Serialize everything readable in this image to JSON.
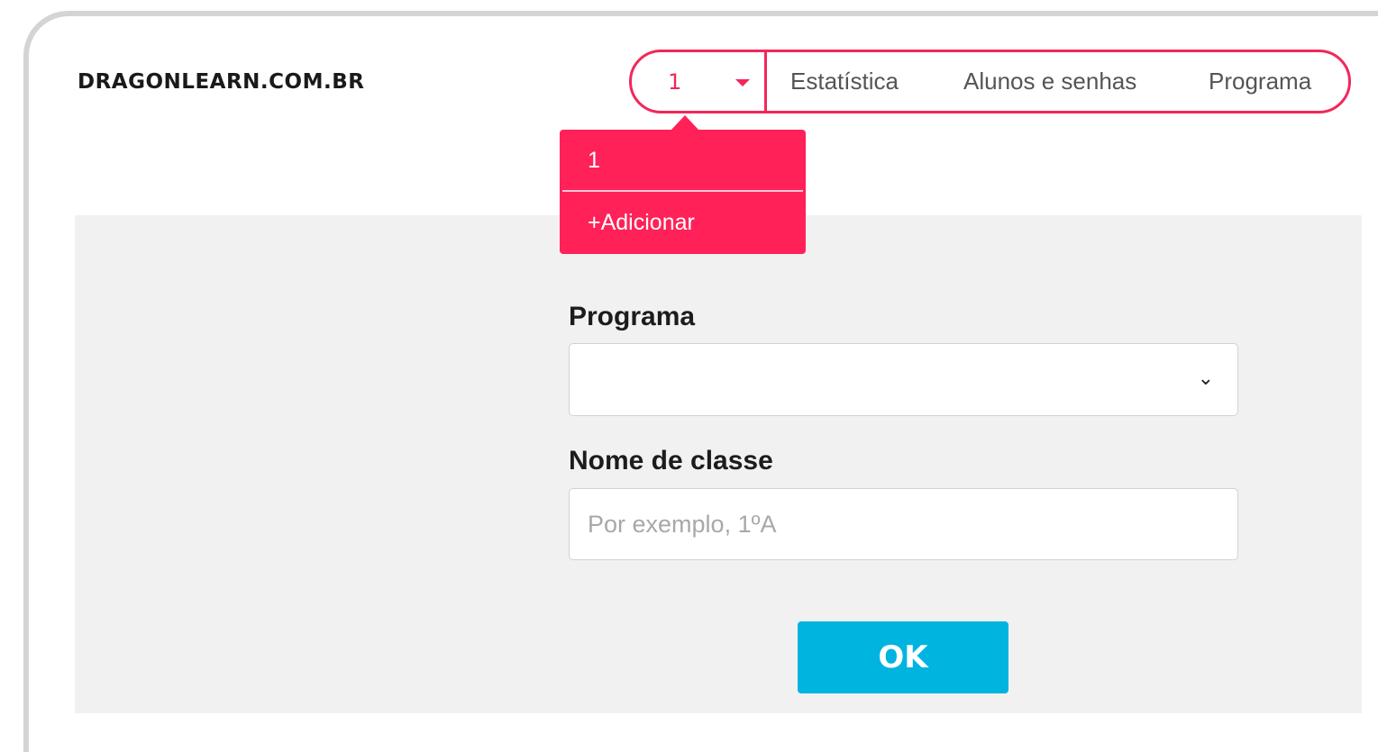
{
  "header": {
    "logo": "DRAGONLEARN.COM.BR",
    "class_selector": {
      "value": "1",
      "icon": "caret-down-icon"
    },
    "nav": [
      {
        "label": "Estatística"
      },
      {
        "label": "Alunos e senhas"
      },
      {
        "label": "Programa"
      }
    ]
  },
  "class_dropdown": {
    "items": [
      {
        "label": "1"
      },
      {
        "label": "+Adicionar"
      }
    ]
  },
  "form": {
    "program_label": "Programa",
    "program_value": "",
    "program_icon": "chevron-down-icon",
    "class_name_label": "Nome de classe",
    "class_name_value": "",
    "class_name_placeholder": "Por exemplo, 1ºA",
    "ok_label": "OK"
  },
  "colors": {
    "accent": "#f2275a",
    "dropdown_bg": "#ff2158",
    "button": "#00b4e0",
    "panel_bg": "#f1f1f1"
  }
}
